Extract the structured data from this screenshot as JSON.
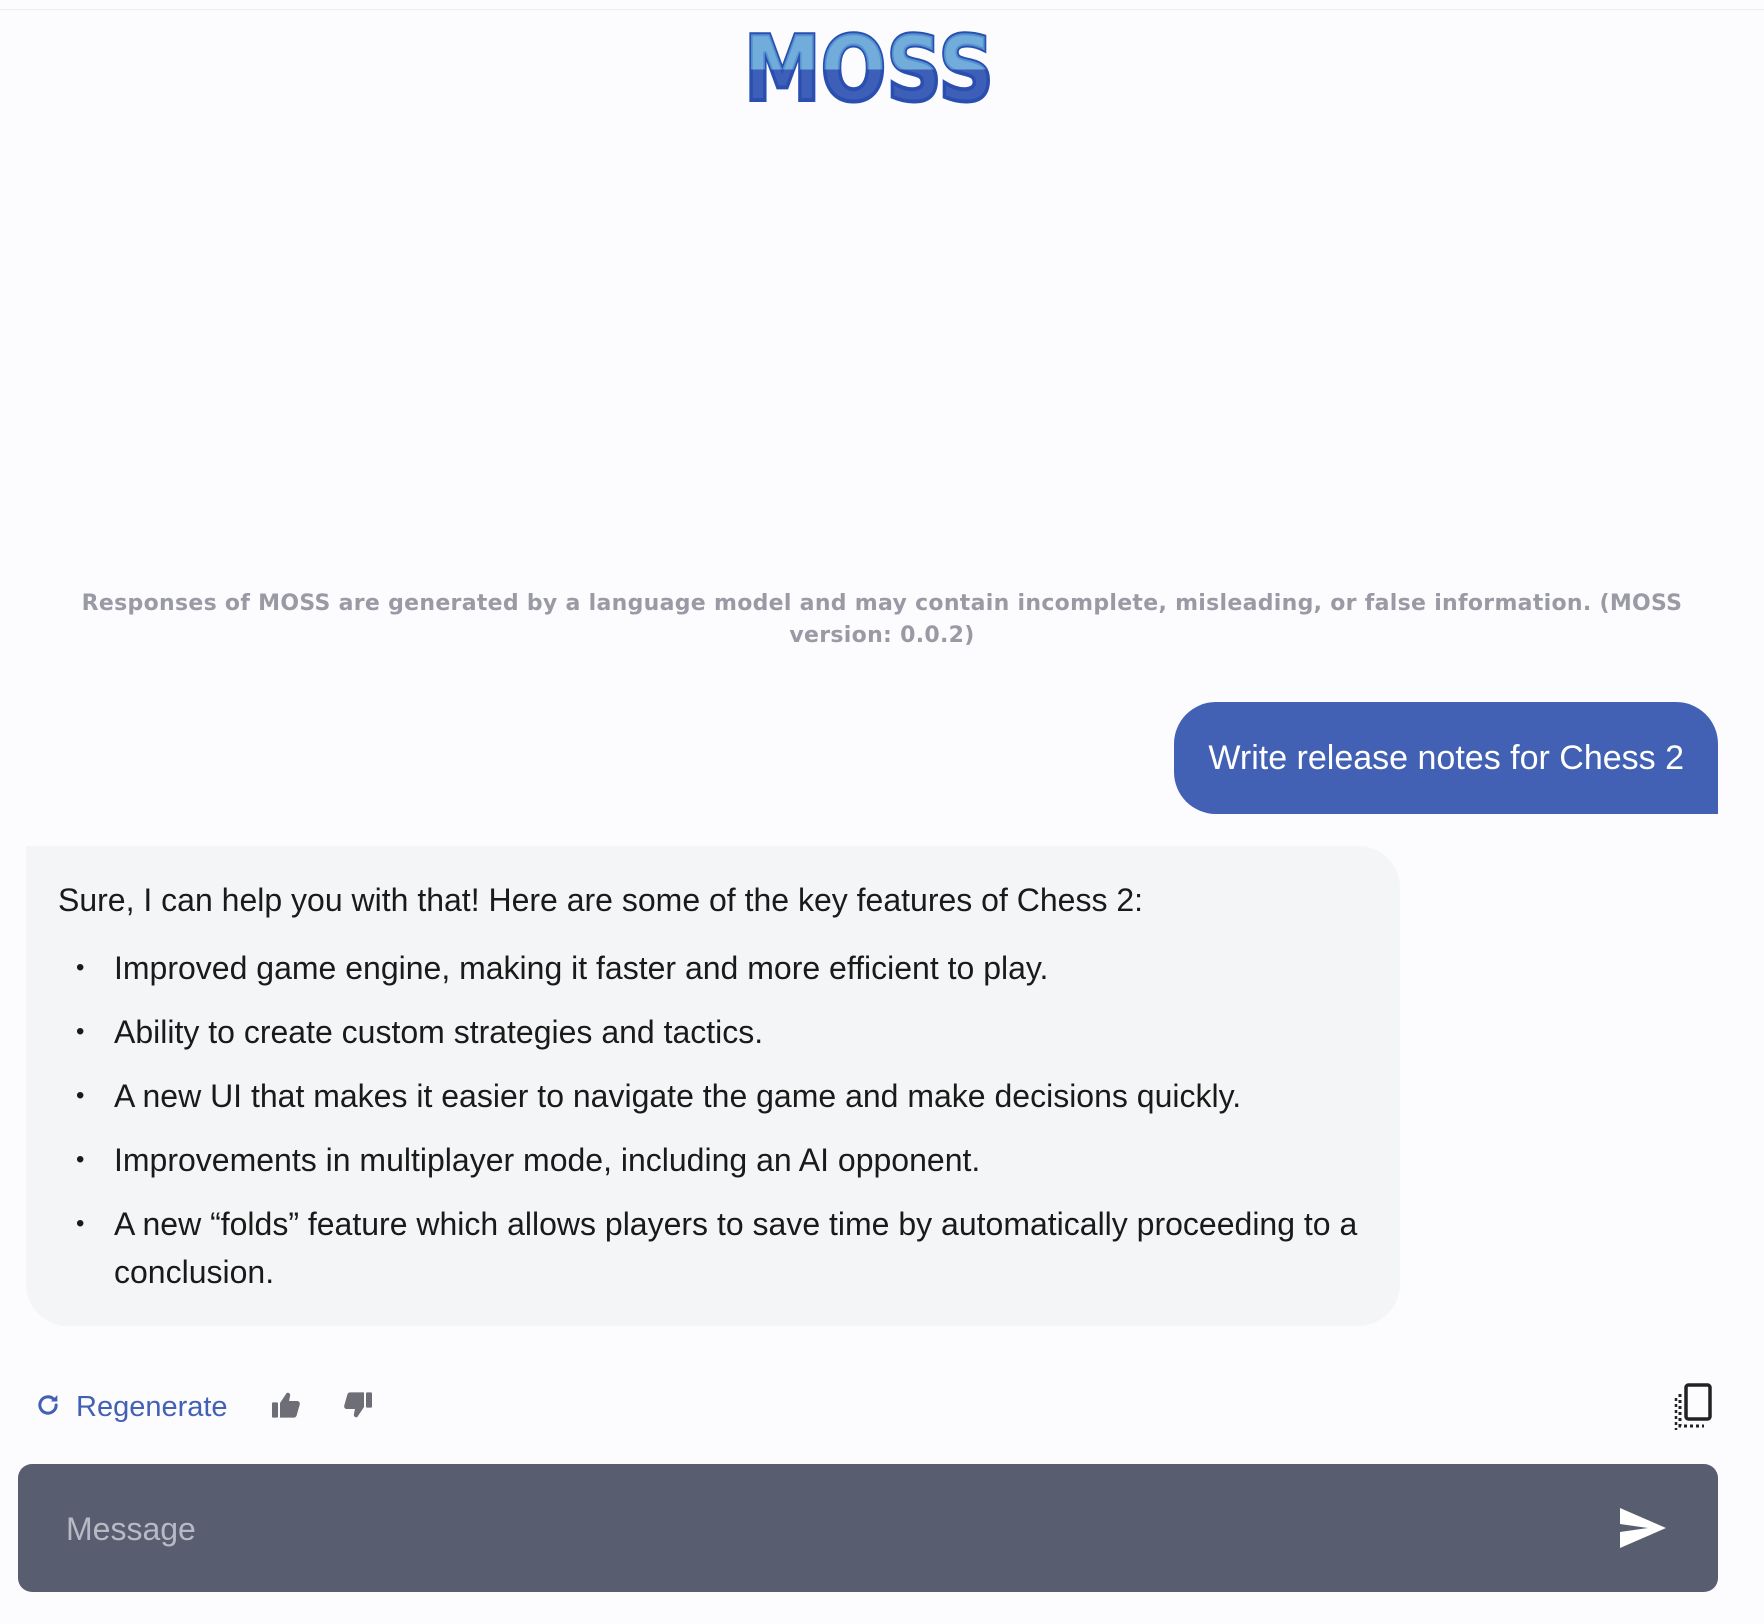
{
  "app": {
    "logo_text": "MOSS",
    "disclaimer": "Responses of MOSS are generated by a language model and may contain incomplete, misleading, or false information. (MOSS version: 0.0.2)"
  },
  "conversation": {
    "user_message": "Write release notes for Chess 2",
    "assistant_intro": "Sure, I can help you with that! Here are some of the key features of Chess 2:",
    "assistant_bullets": [
      "Improved game engine, making it faster and more efficient to play.",
      "Ability to create custom strategies and tactics.",
      "A new UI that makes it easier to navigate the game and make decisions quickly.",
      "Improvements in multiplayer mode, including an AI opponent.",
      "A new “folds” feature which allows players to save time by automatically proceeding to a conclusion."
    ]
  },
  "actions": {
    "regenerate_label": "Regenerate",
    "icons": [
      "refresh-icon",
      "thumbs-up-icon",
      "thumbs-down-icon",
      "copy-icon"
    ]
  },
  "composer": {
    "placeholder": "Message",
    "value": "",
    "send_icon": "send-icon"
  },
  "colors": {
    "accent": "#4361b4",
    "logo_dark": "#2a4fb0",
    "logo_light": "#5b9fd6",
    "composer_bg": "#585e70",
    "assistant_bubble_bg": "#f4f5f6",
    "disclaimer_text": "#9a9aa5"
  }
}
